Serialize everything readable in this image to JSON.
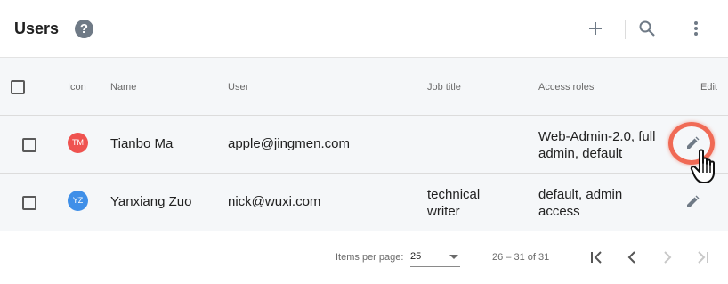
{
  "header": {
    "title": "Users",
    "help_glyph": "?",
    "icons": {
      "help": "help-icon",
      "add": "plus-icon",
      "search": "search-icon",
      "more": "more-vert-icon"
    }
  },
  "table": {
    "columns": {
      "icon": "Icon",
      "name": "Name",
      "user": "User",
      "job_title": "Job title",
      "access_roles": "Access roles",
      "edit": "Edit"
    },
    "rows": [
      {
        "initials": "TM",
        "avatar_color": "#ef5350",
        "name": "Tianbo Ma",
        "user": "apple@jingmen.com",
        "job_title_line1": "",
        "job_title_line2": "",
        "access_roles_line1": "Web-Admin-2.0, full",
        "access_roles_line2": "admin, default"
      },
      {
        "initials": "YZ",
        "avatar_color": "#3f8fe8",
        "name": "Yanxiang Zuo",
        "user": "nick@wuxi.com",
        "job_title_line1": "technical",
        "job_title_line2": "writer",
        "access_roles_line1": "default, admin",
        "access_roles_line2": "access"
      }
    ]
  },
  "pagination": {
    "items_per_page_label": "Items per page:",
    "items_per_page_value": "25",
    "range_label": "26 – 31 of 31"
  },
  "colors": {
    "highlight_ring": "#f06a55",
    "icon_gray": "#6f7a86"
  }
}
